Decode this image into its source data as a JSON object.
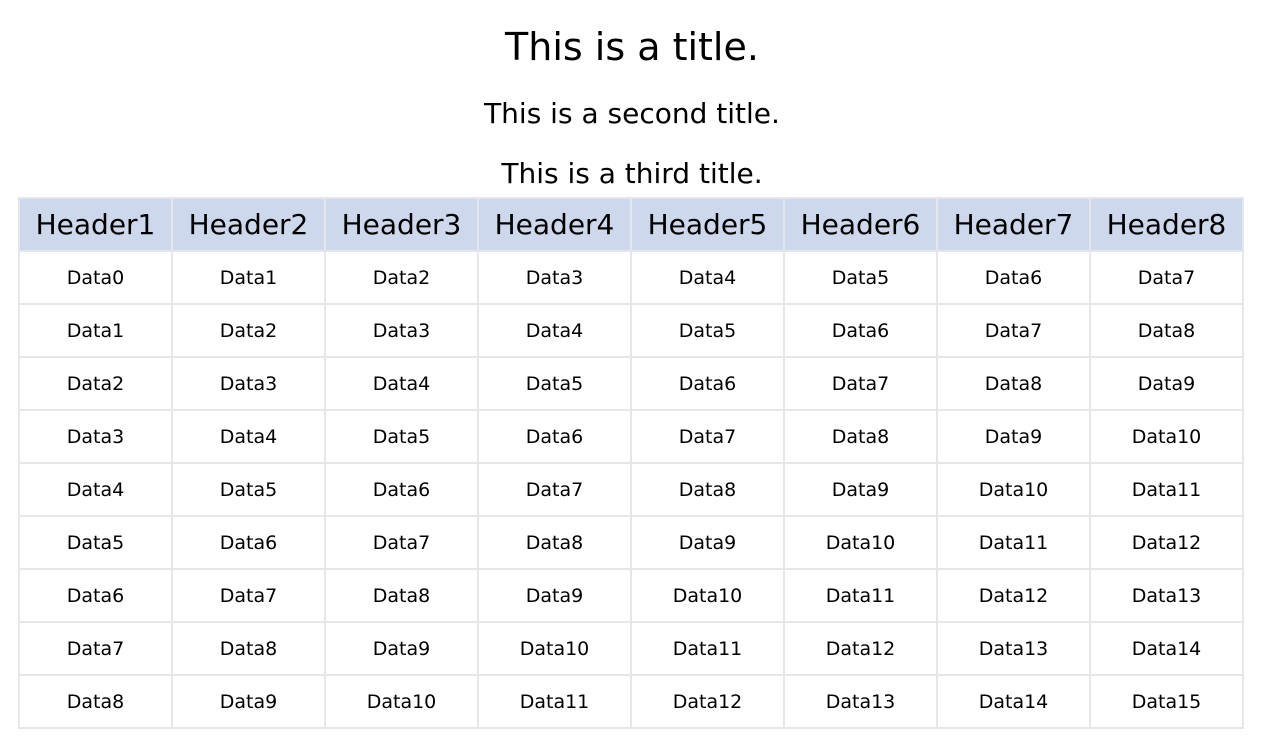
{
  "titles": {
    "main": "This is a title.",
    "second": "This is a second title.",
    "third": "This is a third title."
  },
  "colors": {
    "header_bg": "#cdd8ec",
    "grid_line": "#e7e7e7"
  },
  "table": {
    "headers": [
      "Header1",
      "Header2",
      "Header3",
      "Header4",
      "Header5",
      "Header6",
      "Header7",
      "Header8"
    ],
    "rows": [
      [
        "Data0",
        "Data1",
        "Data2",
        "Data3",
        "Data4",
        "Data5",
        "Data6",
        "Data7"
      ],
      [
        "Data1",
        "Data2",
        "Data3",
        "Data4",
        "Data5",
        "Data6",
        "Data7",
        "Data8"
      ],
      [
        "Data2",
        "Data3",
        "Data4",
        "Data5",
        "Data6",
        "Data7",
        "Data8",
        "Data9"
      ],
      [
        "Data3",
        "Data4",
        "Data5",
        "Data6",
        "Data7",
        "Data8",
        "Data9",
        "Data10"
      ],
      [
        "Data4",
        "Data5",
        "Data6",
        "Data7",
        "Data8",
        "Data9",
        "Data10",
        "Data11"
      ],
      [
        "Data5",
        "Data6",
        "Data7",
        "Data8",
        "Data9",
        "Data10",
        "Data11",
        "Data12"
      ],
      [
        "Data6",
        "Data7",
        "Data8",
        "Data9",
        "Data10",
        "Data11",
        "Data12",
        "Data13"
      ],
      [
        "Data7",
        "Data8",
        "Data9",
        "Data10",
        "Data11",
        "Data12",
        "Data13",
        "Data14"
      ],
      [
        "Data8",
        "Data9",
        "Data10",
        "Data11",
        "Data12",
        "Data13",
        "Data14",
        "Data15"
      ]
    ]
  }
}
